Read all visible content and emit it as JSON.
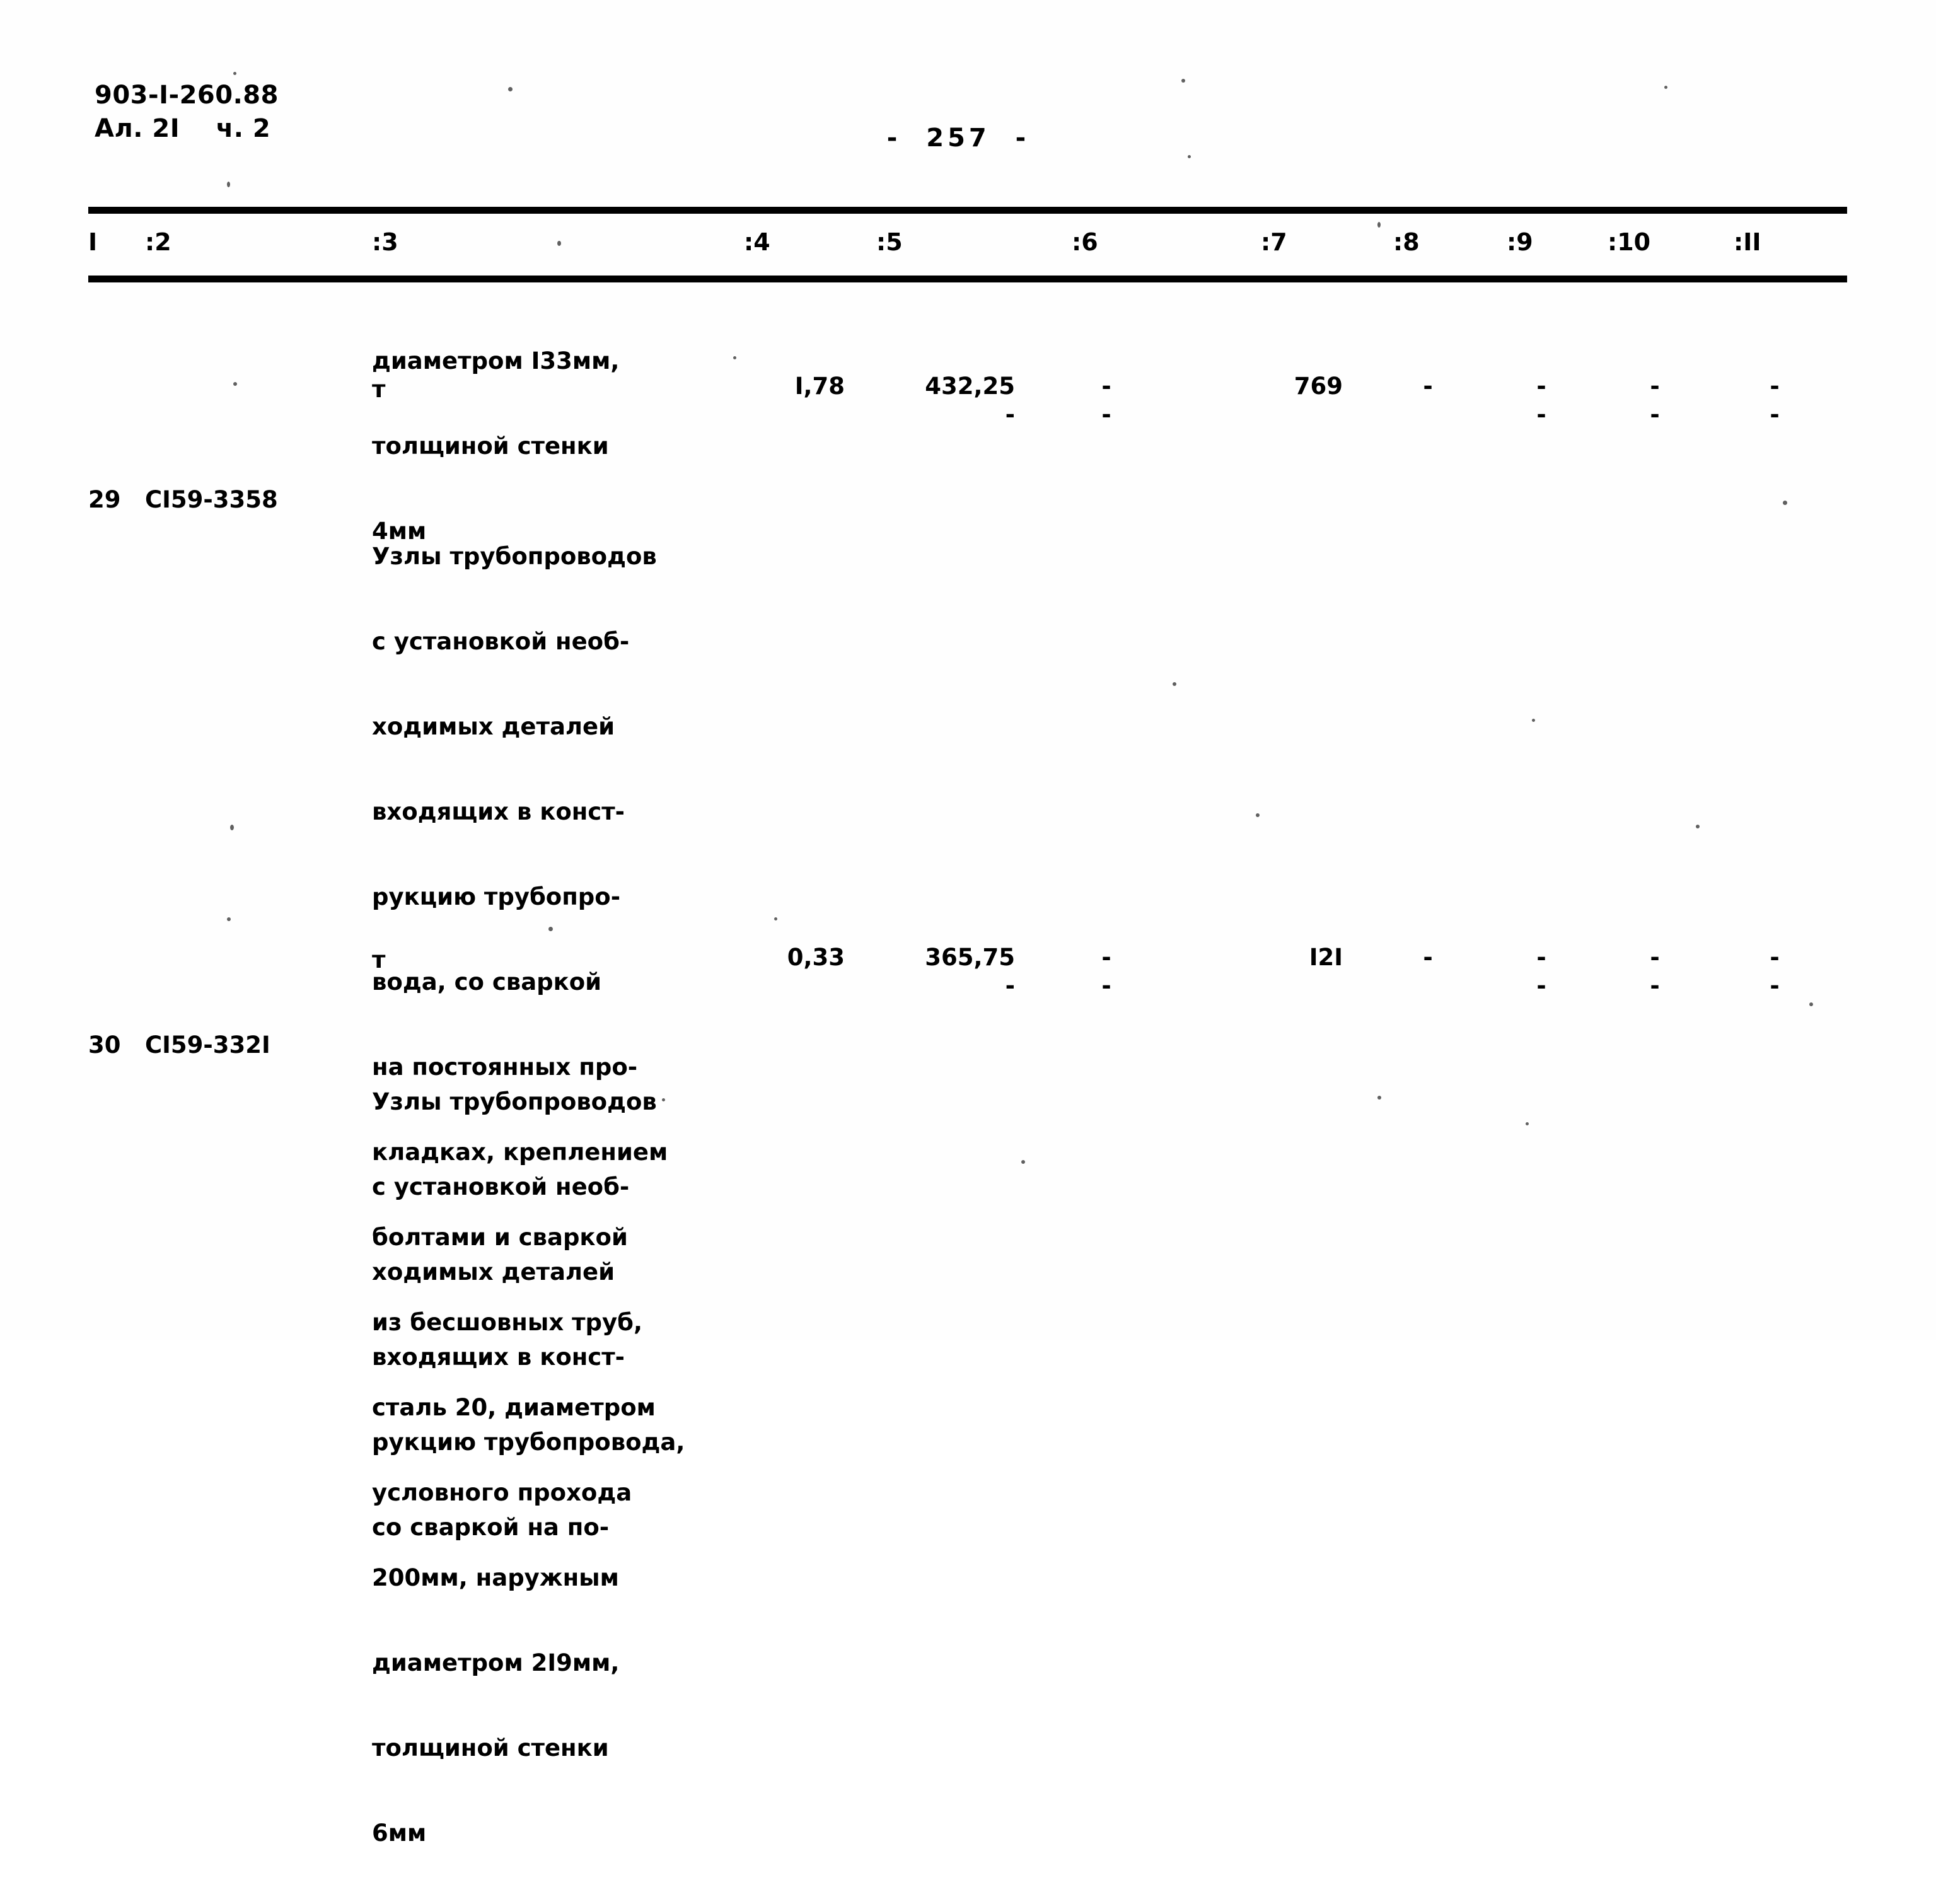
{
  "document": {
    "code": "903-I-260.88",
    "album": "Ал. 2I    ч. 2",
    "page_number": "-  257  -"
  },
  "table": {
    "column_headers": [
      "I",
      ":2",
      ":3",
      ":4",
      ":5",
      ":6",
      ":7",
      ":8",
      ":9",
      ":10",
      ":II"
    ],
    "rows": [
      {
        "number": "",
        "code": "",
        "description_lines": [
          "диаметром I33мм,",
          "толщиной стенки",
          "4мм"
        ],
        "unit": "т",
        "col4": "I,78",
        "col5": "432,25",
        "col5_sub": "-",
        "col6": "-",
        "col6_sub": "-",
        "col7": "769",
        "col8": "-",
        "col9": "-",
        "col9_sub": "-",
        "col10": "-",
        "col10_sub": "-",
        "col11": "-",
        "col11_sub": "-"
      },
      {
        "number": "29",
        "code": "CI59-3358",
        "description_lines": [
          "Узлы трубопроводов",
          "с установкой необ-",
          "ходимых деталей",
          "входящих в конст-",
          "рукцию трубопро-",
          "вода, со сваркой",
          "на постоянных про-",
          "кладках, креплением",
          "болтами и сваркой",
          "из бесшовных труб,",
          "сталь 20, диаметром",
          "условного прохода",
          "200мм, наружным",
          "диаметром 2I9мм,",
          "толщиной стенки",
          "6мм"
        ],
        "unit": "т",
        "col4": "0,33",
        "col5": "365,75",
        "col5_sub": "-",
        "col6": "-",
        "col6_sub": "-",
        "col7": "I2I",
        "col8": "-",
        "col9": "-",
        "col9_sub": "-",
        "col10": "-",
        "col10_sub": "-",
        "col11": "-",
        "col11_sub": "-"
      },
      {
        "number": "30",
        "code": "CI59-332I",
        "description_lines": [
          "Узлы трубопроводов",
          "с установкой необ-",
          "ходимых деталей",
          "входящих в конст-",
          "рукцию трубопровода,",
          "со сваркой на по-"
        ],
        "unit": "",
        "col4": "",
        "col5": "",
        "col6": "",
        "col7": "",
        "col8": "",
        "col9": "",
        "col10": "",
        "col11": ""
      }
    ]
  }
}
